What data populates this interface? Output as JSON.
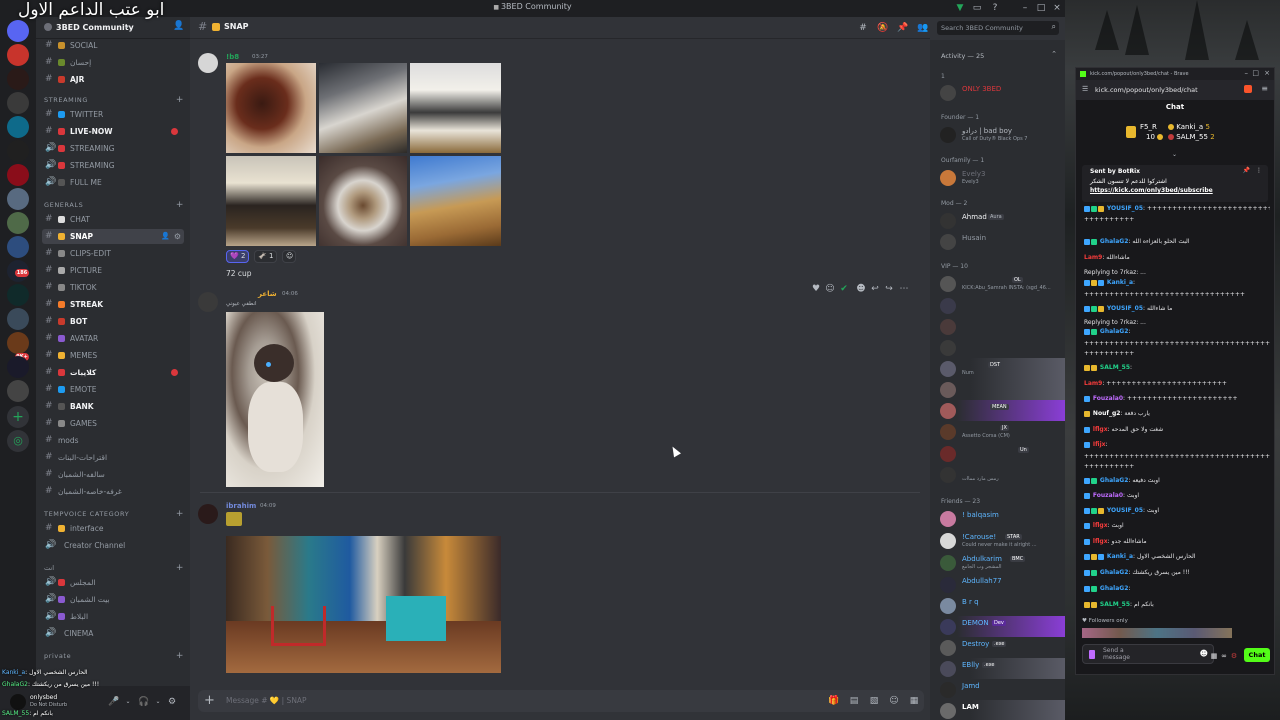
{
  "overlay_title": "ابو عتب الداعم الاول",
  "window": {
    "title": "3BED Community"
  },
  "server": {
    "name": "3BED Community"
  },
  "channels": [
    {
      "label": "SOCIAL",
      "kind": "text",
      "bold": false
    },
    {
      "label": "إحسان",
      "kind": "text",
      "bold": false
    },
    {
      "label": "AJR",
      "kind": "text",
      "bold": true
    },
    {
      "label": "TWITTER",
      "kind": "text",
      "bold": false
    },
    {
      "label": "LIVE-NOW",
      "kind": "text",
      "bold": true,
      "unread": true
    },
    {
      "label": "STREAMING",
      "kind": "voice",
      "bold": false
    },
    {
      "label": "STREAMING",
      "kind": "voice",
      "bold": false
    },
    {
      "label": "FULL ME",
      "kind": "voice",
      "bold": false
    },
    {
      "label": "CHAT",
      "kind": "text",
      "bold": false
    },
    {
      "label": "SNAP",
      "kind": "text",
      "bold": true,
      "active": true
    },
    {
      "label": "CLIPS-EDIT",
      "kind": "text",
      "bold": false
    },
    {
      "label": "PICTURE",
      "kind": "text",
      "bold": false
    },
    {
      "label": "TIKTOK",
      "kind": "text",
      "bold": false
    },
    {
      "label": "STREAK",
      "kind": "text",
      "bold": true
    },
    {
      "label": "BOT",
      "kind": "text",
      "bold": true
    },
    {
      "label": "AVATAR",
      "kind": "text",
      "bold": false
    },
    {
      "label": "MEMES",
      "kind": "text",
      "bold": false
    },
    {
      "label": "كلايبات",
      "kind": "text",
      "bold": true,
      "unread": true
    },
    {
      "label": "EMOTE",
      "kind": "text",
      "bold": false
    },
    {
      "label": "BANK",
      "kind": "text",
      "bold": true
    },
    {
      "label": "GAMES",
      "kind": "text",
      "bold": false
    },
    {
      "label": "mods",
      "kind": "text",
      "bold": false
    },
    {
      "label": "اقتراحات-البنات",
      "kind": "text",
      "bold": false
    },
    {
      "label": "سالفه-الشمبان",
      "kind": "text",
      "bold": false
    },
    {
      "label": "غرفه-خاصه-الشمبان",
      "kind": "text",
      "bold": false
    }
  ],
  "categories": {
    "streaming": "STREAMING",
    "general": "GENERALS",
    "tempvoice": "TEMPVOICE CATEGORY",
    "other": "انت",
    "private": "private"
  },
  "tempvoice": {
    "interface": "interface",
    "creator": "Creator Channel"
  },
  "other_voice": [
    "المجلس",
    "بيت الشمبان",
    "البلاط",
    "CINEMA"
  ],
  "user_overlay": [
    {
      "user": "Kanki_a",
      "text": "الحارس الشخصي الاول"
    },
    {
      "user": "GhalaG2",
      "text": "مين يسرق من ريكشتك !!!"
    },
    {
      "user": "SALM_55",
      "text": "بانكم ام"
    }
  ],
  "user_panel": {
    "name": "onlysbed",
    "status": "Do Not Disturb"
  },
  "chat": {
    "channel": "SNAP",
    "composer_placeholder": "Message # 💛 | SNAP",
    "messages": [
      {
        "author": "!b8",
        "time": "03:27",
        "reactions": [
          {
            "emoji": "💜",
            "count": "2"
          },
          {
            "emoji": "🫏",
            "count": "1"
          }
        ],
        "caption": "72 cup"
      },
      {
        "author": "شاعر",
        "time": "04:06",
        "subtitle": "انطفي عيوني"
      },
      {
        "author": "ibrahim",
        "time": "04:09"
      }
    ]
  },
  "search": {
    "placeholder": "Search 3BED Community"
  },
  "members": {
    "activity": "Activity — 25",
    "groups": [
      {
        "label": "1",
        "members": [
          {
            "name": "ONLY 3BED",
            "status": ""
          }
        ]
      },
      {
        "label": "Founder — 1",
        "members": [
          {
            "name": "درادو | bad boy",
            "status": "Call of Duty® Black Ops 7"
          }
        ]
      },
      {
        "label": "Ourfamily — 1",
        "members": [
          {
            "name": "Evely3",
            "status": "Evely3"
          }
        ]
      },
      {
        "label": "Mod — 2",
        "members": [
          {
            "name": "Ahmad",
            "status": "",
            "tag": "Aura"
          },
          {
            "name": "Husain",
            "status": ""
          }
        ]
      },
      {
        "label": "VIP — 10",
        "members": [
          {
            "name": "",
            "status": "KICK:Abu_Samrah INSTA: (sgd_46...",
            "tag": "OL"
          },
          {
            "name": "",
            "status": ""
          },
          {
            "name": "",
            "status": ""
          },
          {
            "name": "",
            "status": ""
          },
          {
            "name": "",
            "status": "Num",
            "tag": "DST"
          },
          {
            "name": "",
            "status": ""
          },
          {
            "name": "",
            "status": "",
            "tag": "MEAN"
          },
          {
            "name": "",
            "status": "Assetto Corsa (CM)",
            "tag": "JX"
          },
          {
            "name": "",
            "status": "",
            "tag": "Un"
          },
          {
            "name": "",
            "status": "رمس مارد مماات"
          }
        ]
      },
      {
        "label": "Friends — 23",
        "members": [
          {
            "name": "! balqasim",
            "status": ""
          },
          {
            "name": "!Carouse!",
            "status": "Could never make it alright ...",
            "tag": "STAR"
          },
          {
            "name": "Abdulkarim",
            "status": "المشجر وب الجامع",
            "tag": "BMC"
          },
          {
            "name": "Abdullah77",
            "status": ""
          },
          {
            "name": "B r q",
            "status": ""
          },
          {
            "name": "DEMON",
            "status": "",
            "tag": "Dev"
          },
          {
            "name": "Destroy",
            "status": "",
            "tag": ".exe"
          },
          {
            "name": "EBlly",
            "status": "",
            "tag": ".exe"
          },
          {
            "name": "Jamd",
            "status": ""
          },
          {
            "name": "LAM",
            "status": ""
          }
        ]
      }
    ]
  },
  "kick": {
    "tab_title": "kick.com/popout/only3bed/chat - Brave",
    "url": "kick.com/popout/only3bed/chat",
    "header": "Chat",
    "leaderboard": [
      {
        "name": "F5_R",
        "value": "10",
        "name2": "Kanki_a",
        "value2": "5"
      },
      {
        "name2": "SALM_55",
        "value2": "2"
      }
    ],
    "pinned": {
      "sender": "Sent by BotRix",
      "text": "اشتركوا للدعم لا تنسون الشكر",
      "link": "https://kick.com/only3bed/subscribe"
    },
    "messages": [
      {
        "user": "YOUSIF_05",
        "text": "++++++++++++++++++++++++++++++++++++++++++"
      },
      {
        "user": "",
        "text": "++++++++++"
      },
      {
        "user": "GhalaG2",
        "text": "البث الحلو بالعزاءه الله"
      },
      {
        "user": "Lam9",
        "text": "ماشاءالله"
      },
      {
        "user": "",
        "text": "Replying to 7rkaz: ..."
      },
      {
        "user": "Kanki_a",
        "text": ""
      },
      {
        "user": "",
        "text": "++++++++++++++++++++++++++++++++"
      },
      {
        "user": "YOUSIF_05",
        "text": "ما شاءالله"
      },
      {
        "user": "",
        "text": "Replying to 7rkaz: ..."
      },
      {
        "user": "GhalaG2",
        "text": ""
      },
      {
        "user": "",
        "text": "+++++++++++++++++++++++++++++++++++++++++++++"
      },
      {
        "user": "",
        "text": "++++++++++"
      },
      {
        "user": "SALM_55",
        "text": ""
      },
      {
        "user": "Lam9",
        "text": "++++++++++++++++++++++++"
      },
      {
        "user": "Fouzala0",
        "text": "++++++++++++++++++++++"
      },
      {
        "user": "Nouf_g2",
        "text": "يارب دفعة"
      },
      {
        "user": "lflgx",
        "text": "شغت ولا حق المدحه"
      },
      {
        "user": "Ifijx",
        "text": ""
      },
      {
        "user": "",
        "text": "+++++++++++++++++++++++++++++++++++++++++"
      },
      {
        "user": "",
        "text": "++++++++++"
      },
      {
        "user": "GhalaG2",
        "text": "اوبث دفيعه"
      },
      {
        "user": "Fouzala0",
        "text": "اوبث"
      },
      {
        "user": "YOUSIF_05",
        "text": "اوبث"
      },
      {
        "user": "lflgx",
        "text": "اوبث"
      },
      {
        "user": "lflgx",
        "text": "ماشاءالله جدو"
      },
      {
        "user": "Kanki_a",
        "text": "الحارس الشخصي الاول"
      },
      {
        "user": "GhalaG2",
        "text": "مين يسرق ريكشتك !!!"
      },
      {
        "user": "GhalaG2",
        "text": ""
      },
      {
        "user": "SALM_55",
        "text": "بانكم ام"
      }
    ],
    "followers_only": "Followers only",
    "input_placeholder": "Send a message",
    "send": "Chat"
  }
}
